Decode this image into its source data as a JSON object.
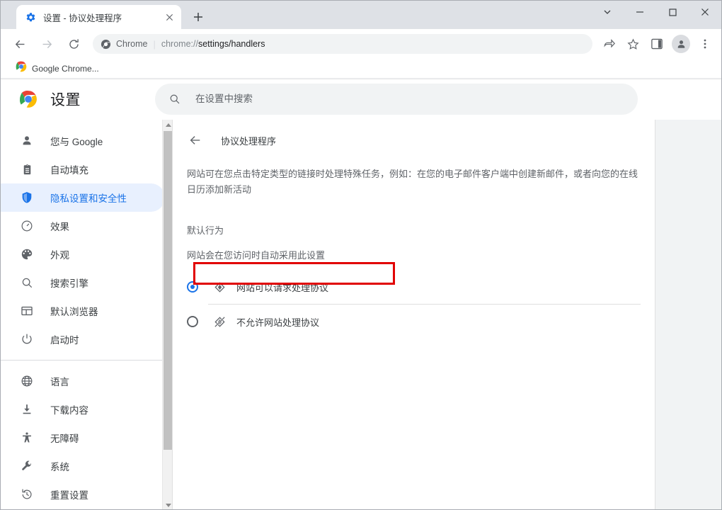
{
  "window": {
    "controls": [
      {
        "name": "tab-search",
        "glyph": "⌄"
      },
      {
        "name": "minimize",
        "glyph": "—"
      },
      {
        "name": "maximize",
        "glyph": "☐"
      },
      {
        "name": "close",
        "glyph": "✕"
      }
    ]
  },
  "tabstrip": {
    "tab_title": "设置 - 协议处理程序",
    "tab_favicon": "gear-icon",
    "close_glyph": "✕",
    "newtab_glyph": "+"
  },
  "toolbar": {
    "back_glyph": "←",
    "forward_glyph": "→",
    "reload_glyph": "⟳",
    "omnibox": {
      "scheme_label": "Chrome",
      "separator": "|",
      "url_prefix": "chrome://",
      "url_bold": "settings/handlers"
    },
    "icons": [
      {
        "name": "share-icon"
      },
      {
        "name": "bookmark-star-icon"
      },
      {
        "name": "side-panel-icon"
      },
      {
        "name": "profile-avatar"
      },
      {
        "name": "more-menu-icon"
      }
    ]
  },
  "bookmarks": {
    "items": [
      {
        "label": "Google Chrome...",
        "icon": "chrome-logo-icon"
      }
    ]
  },
  "settings_header": {
    "title": "设置",
    "logo": "chrome-logo-icon",
    "search_placeholder": "在设置中搜索",
    "search_value": ""
  },
  "sidebar": {
    "items": [
      {
        "label": "您与 Google",
        "icon": "person-icon",
        "selected": false
      },
      {
        "label": "自动填充",
        "icon": "clipboard-icon",
        "selected": false
      },
      {
        "label": "隐私设置和安全性",
        "icon": "shield-icon",
        "selected": true
      },
      {
        "label": "效果",
        "icon": "speedometer-icon",
        "selected": false
      },
      {
        "label": "外观",
        "icon": "palette-icon",
        "selected": false
      },
      {
        "label": "搜索引擎",
        "icon": "search-icon",
        "selected": false
      },
      {
        "label": "默认浏览器",
        "icon": "browser-window-icon",
        "selected": false
      },
      {
        "label": "启动时",
        "icon": "power-icon",
        "selected": false
      }
    ],
    "items_secondary": [
      {
        "label": "语言",
        "icon": "globe-icon",
        "selected": false
      },
      {
        "label": "下载内容",
        "icon": "download-icon",
        "selected": false
      },
      {
        "label": "无障碍",
        "icon": "accessibility-icon",
        "selected": false
      },
      {
        "label": "系统",
        "icon": "wrench-icon",
        "selected": false
      },
      {
        "label": "重置设置",
        "icon": "history-restore-icon",
        "selected": false
      }
    ]
  },
  "content": {
    "back_glyph": "←",
    "page_title": "协议处理程序",
    "description": "网站可在您点击特定类型的链接时处理特殊任务，例如：在您的电子邮件客户端中创建新邮件，或者向您的在线日历添加新活动",
    "section_title": "默认行为",
    "section_subtitle": "网站会在您访问时自动采用此设置",
    "options": [
      {
        "label": "网站可以请求处理协议",
        "icon": "protocol-handler-icon",
        "checked": true,
        "highlighted": true
      },
      {
        "label": "不允许网站处理协议",
        "icon": "protocol-handler-blocked-icon",
        "checked": false,
        "highlighted": false
      }
    ]
  },
  "colors": {
    "accent": "#1a73e8",
    "selected_pill": "#e8f0fe",
    "annotation_red": "#e10000",
    "text_primary": "#202124",
    "text_secondary": "#5f6368"
  }
}
